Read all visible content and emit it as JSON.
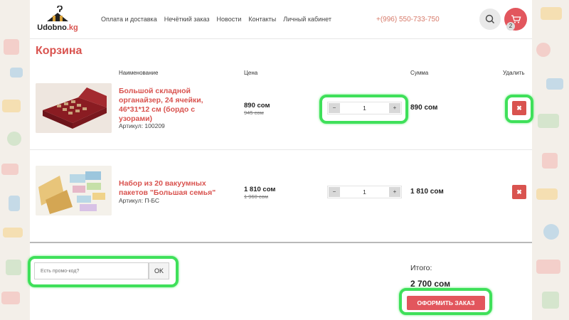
{
  "header": {
    "logo_word": "Udobno",
    "logo_tld": ".kg",
    "nav": [
      "Оплата и доставка",
      "Нечёткий заказ",
      "Новости",
      "Контакты",
      "Личный кабинет"
    ],
    "phone": "+(996) 550-733-750",
    "cart_count": "2"
  },
  "page_title": "Корзина",
  "columns": {
    "name": "Наименование",
    "price": "Цена",
    "sum": "Сумма",
    "delete": "Удалить"
  },
  "items": [
    {
      "name_lines": [
        "Большой складной",
        "органайзер, 24 ячейки,",
        "46*31*12 см (бордо с",
        "узорами)"
      ],
      "article": "Артикул: 100209",
      "price": "890 сом",
      "old_price": "945 сом",
      "quantity": "1",
      "sum": "890 сом"
    },
    {
      "name_lines": [
        "Набор из 20 вакуумных",
        "пакетов \"Большая семья\""
      ],
      "article": "Артикул: П-БС",
      "price": "1 810 сом",
      "old_price": "1 960 сом",
      "quantity": "1",
      "sum": "1 810 сом"
    }
  ],
  "qty_controls": {
    "dec": "−",
    "inc": "+"
  },
  "delete_glyph": "✖",
  "promo": {
    "placeholder": "Есть промо-код?",
    "button": "OK"
  },
  "total": {
    "label": "Итого:",
    "value": "2 700 сом"
  },
  "checkout_button": "ОФОРМИТЬ ЗАКАЗ",
  "colors": {
    "accent": "#d9534f",
    "highlight": "#3fe05a"
  }
}
